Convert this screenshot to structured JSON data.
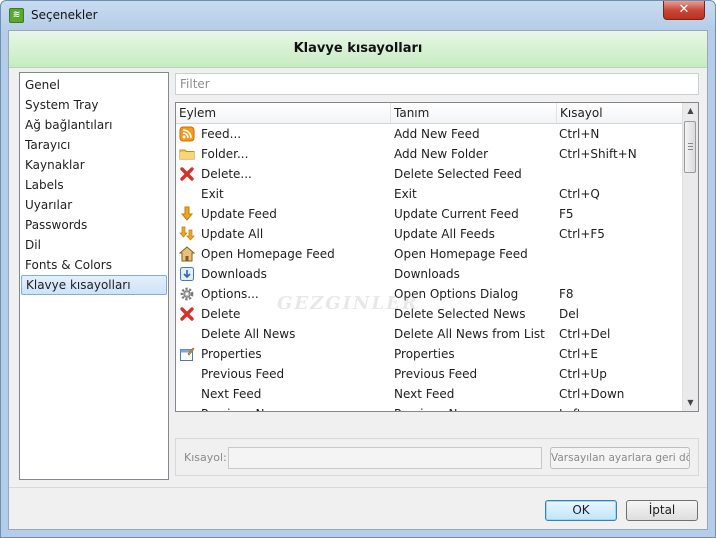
{
  "window": {
    "title": "Seçenekler",
    "close_label": "✕"
  },
  "header": {
    "title": "Klavye kısayolları"
  },
  "sidebar": {
    "items": [
      {
        "label": "Genel",
        "name": "sidebar-item-genel"
      },
      {
        "label": "System Tray",
        "name": "sidebar-item-system-tray"
      },
      {
        "label": "Ağ bağlantıları",
        "name": "sidebar-item-ag-baglantilari"
      },
      {
        "label": "Tarayıcı",
        "name": "sidebar-item-tarayici"
      },
      {
        "label": "Kaynaklar",
        "name": "sidebar-item-kaynaklar"
      },
      {
        "label": "Labels",
        "name": "sidebar-item-labels"
      },
      {
        "label": "Uyarılar",
        "name": "sidebar-item-uyarilar"
      },
      {
        "label": "Passwords",
        "name": "sidebar-item-passwords"
      },
      {
        "label": "Dil",
        "name": "sidebar-item-dil"
      },
      {
        "label": "Fonts & Colors",
        "name": "sidebar-item-fonts-colors"
      },
      {
        "label": "Klavye kısayolları",
        "name": "sidebar-item-klavye-kisayollari",
        "selected": true
      }
    ]
  },
  "filter": {
    "placeholder": "Filter",
    "value": ""
  },
  "table": {
    "columns": [
      "Eylem",
      "Tanım",
      "Kısayol"
    ],
    "rows": [
      {
        "icon": "rss-feed-icon",
        "action": "Feed...",
        "description": "Add New Feed",
        "shortcut": "Ctrl+N"
      },
      {
        "icon": "folder-icon",
        "action": "Folder...",
        "description": "Add New Folder",
        "shortcut": "Ctrl+Shift+N"
      },
      {
        "icon": "red-x-icon",
        "action": "Delete...",
        "description": "Delete Selected Feed",
        "shortcut": ""
      },
      {
        "icon": "",
        "action": "Exit",
        "description": "Exit",
        "shortcut": "Ctrl+Q"
      },
      {
        "icon": "arrow-down-icon",
        "action": "Update Feed",
        "description": "Update Current Feed",
        "shortcut": "F5"
      },
      {
        "icon": "update-all-icon",
        "action": "Update All",
        "description": "Update All Feeds",
        "shortcut": "Ctrl+F5"
      },
      {
        "icon": "home-icon",
        "action": "Open Homepage Feed",
        "description": "Open Homepage Feed",
        "shortcut": ""
      },
      {
        "icon": "downloads-icon",
        "action": "Downloads",
        "description": "Downloads",
        "shortcut": ""
      },
      {
        "icon": "gear-icon",
        "action": "Options...",
        "description": "Open Options Dialog",
        "shortcut": "F8"
      },
      {
        "icon": "red-x-icon",
        "action": "Delete",
        "description": "Delete Selected News",
        "shortcut": "Del"
      },
      {
        "icon": "",
        "action": "Delete All News",
        "description": "Delete All News from List",
        "shortcut": "Ctrl+Del"
      },
      {
        "icon": "properties-icon",
        "action": "Properties",
        "description": "Properties",
        "shortcut": "Ctrl+E"
      },
      {
        "icon": "",
        "action": "Previous Feed",
        "description": "Previous Feed",
        "shortcut": "Ctrl+Up"
      },
      {
        "icon": "",
        "action": "Next Feed",
        "description": "Next Feed",
        "shortcut": "Ctrl+Down"
      },
      {
        "icon": "",
        "action": "Previous N...",
        "description": "Previous N...",
        "shortcut": "Left"
      }
    ]
  },
  "shortcut_panel": {
    "label": "Kısayol:",
    "value": "",
    "reset_label": "Varsayılan ayarlara geri dön"
  },
  "buttons": {
    "ok": "OK",
    "cancel": "İptal"
  },
  "watermark": "GEZGINLER",
  "colors": {
    "header_green": "#c6ecc2",
    "selection_blue": "#cde3f8",
    "ok_blue": "#bee6fd",
    "close_red": "#c9483a"
  }
}
